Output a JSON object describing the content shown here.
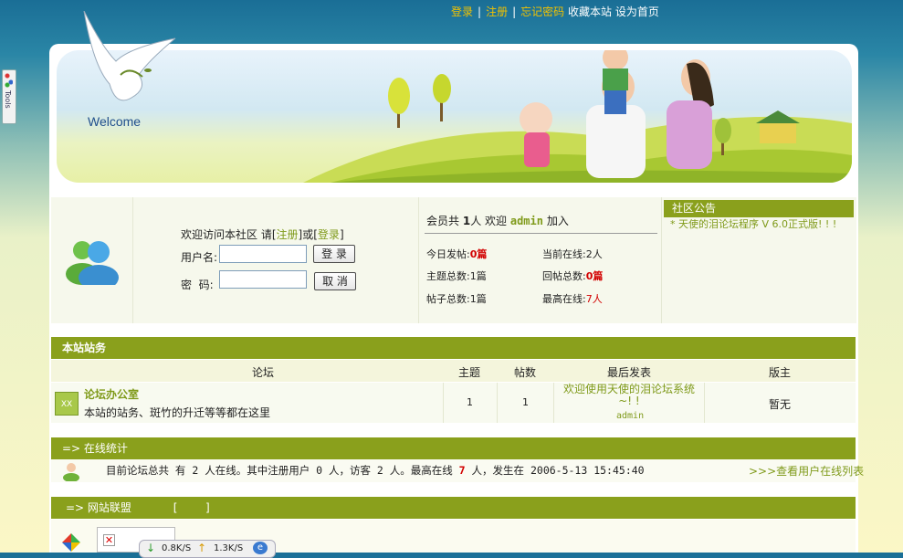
{
  "top_links": {
    "login": "登录",
    "register": "注册",
    "forgot": "忘记密码",
    "favorite": "收藏本站",
    "homepage": "设为首页",
    "separator": "|"
  },
  "tools": {
    "label": "Tools"
  },
  "banner": {
    "welcome": "Welcome"
  },
  "login": {
    "greeting_prefix": "欢迎访问本社区 请",
    "bracket_open": "[",
    "bracket_close": "]",
    "register_link": "注册",
    "or": "或",
    "login_link": "登录",
    "username_label": "用户名:",
    "password_label": "密  码:",
    "username_value": "",
    "password_value": "",
    "login_button": "登 录",
    "cancel_button": "取 消"
  },
  "stats": {
    "members_prefix": "会员共",
    "members_count": "1",
    "members_mid": "人 欢迎",
    "newest_member": "admin",
    "members_suffix": "加入",
    "today_label": "今日发帖:",
    "today_value": "0篇",
    "online_label": "当前在线:",
    "online_value": "2人",
    "topics_label": "主题总数:",
    "topics_value": "1篇",
    "replies_label": "回帖总数:",
    "replies_value": "0篇",
    "posts_label": "帖子总数:",
    "posts_value": "1篇",
    "max_label": "最高在线:",
    "max_value": "7人"
  },
  "notice": {
    "title": "社区公告",
    "text": "* 天使的泪论坛程序 V 6.0正式版! ! !"
  },
  "forum": {
    "section_title": "本站站务",
    "headers": {
      "forum": "论坛",
      "topics": "主题",
      "posts": "帖数",
      "last": "最后发表",
      "moderator": "版主"
    },
    "rows": [
      {
        "icon_text": "XX",
        "name": "论坛办公室",
        "desc": "本站的站务、斑竹的升迁等等都在这里",
        "topics": "1",
        "posts": "1",
        "last_title": "欢迎使用天使的泪论坛系统~! !",
        "last_user": "admin",
        "moderator": "暂无"
      }
    ]
  },
  "online_stats": {
    "title": "=> 在线统计",
    "text": "目前论坛总共 有 2 人在线。其中注册用户 0 人，访客 2 人。最高在线",
    "max": "7",
    "text2": "人，发生在 2006-5-13 15:45:40",
    "link": ">>>查看用户在线列表"
  },
  "alliance": {
    "title": "=> 网站联盟",
    "brackets": "[        ]"
  },
  "netmeter": {
    "down": "0.8K/S",
    "up": "1.3K/S"
  },
  "colors": {
    "accent": "#8aa01c",
    "highlight": "#7f9a1a",
    "red": "#d20000",
    "link_yellow": "#f2c200"
  }
}
